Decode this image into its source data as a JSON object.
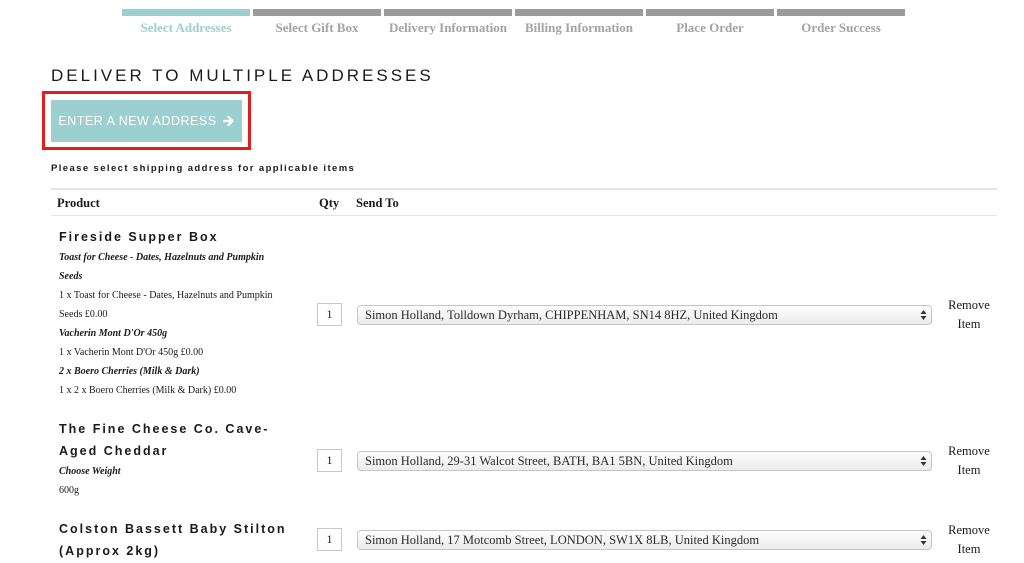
{
  "steps": [
    {
      "label": "Select Addresses",
      "active": true
    },
    {
      "label": "Select Gift Box",
      "active": false
    },
    {
      "label": "Delivery Information",
      "active": false
    },
    {
      "label": "Billing Information",
      "active": false
    },
    {
      "label": "Place Order",
      "active": false
    },
    {
      "label": "Order Success",
      "active": false
    }
  ],
  "page_title": "DELIVER TO MULTIPLE ADDRESSES",
  "new_address_button": {
    "label": "ENTER A NEW ADDRESS",
    "icon": "arrow-right-icon"
  },
  "instruction": "Please select shipping address for applicable items",
  "table": {
    "headers": {
      "product": "Product",
      "qty": "Qty",
      "send_to": "Send To"
    },
    "rows": [
      {
        "product_name": "Fireside Supper Box",
        "options": [
          {
            "title": "Toast for Cheese - Dates, Hazelnuts and Pumpkin Seeds",
            "value": "1 x Toast for Cheese - Dates, Hazelnuts and Pumpkin Seeds £0.00"
          },
          {
            "title": "Vacherin Mont D'Or 450g",
            "value": "1 x Vacherin Mont D'Or 450g £0.00"
          },
          {
            "title": "2 x Boero Cherries (Milk & Dark)",
            "value": "1 x 2 x Boero Cherries (Milk & Dark) £0.00"
          }
        ],
        "qty": "1",
        "address": "Simon Holland, Tolldown Dyrham, CHIPPENHAM, SN14 8HZ, United Kingdom",
        "remove_label": "Remove Item"
      },
      {
        "product_name": "The Fine Cheese Co. Cave-Aged Cheddar",
        "options": [
          {
            "title": "Choose Weight",
            "value": "600g"
          }
        ],
        "qty": "1",
        "address": "Simon Holland, 29-31 Walcot Street, BATH, BA1 5BN, United Kingdom",
        "remove_label": "Remove Item"
      },
      {
        "product_name": "Colston Bassett Baby Stilton (Approx 2kg)",
        "options": [],
        "qty": "1",
        "address": "Simon Holland, 17 Motcomb Street, LONDON, SW1X 8LB, United Kingdom",
        "remove_label": "Remove Item"
      }
    ]
  },
  "colors": {
    "accent": "#9ccfcf",
    "inactive_step": "#9b9b9b",
    "highlight": "#e11d1d"
  }
}
